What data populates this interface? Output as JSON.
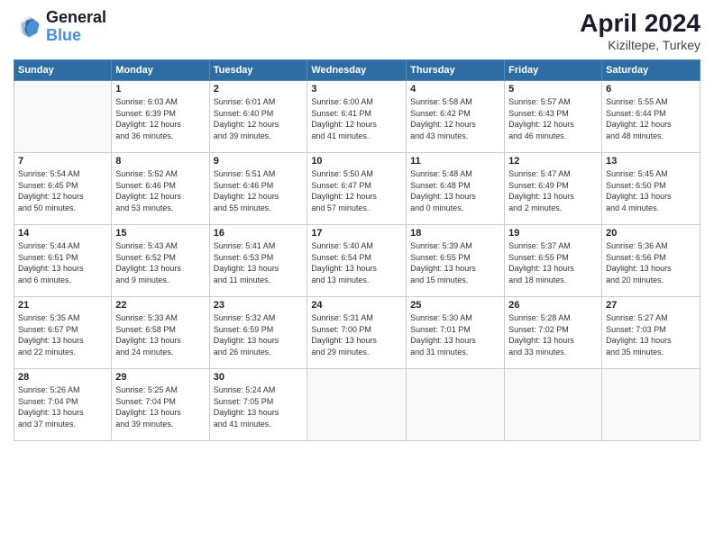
{
  "header": {
    "logo_general": "General",
    "logo_blue": "Blue",
    "month_year": "April 2024",
    "location": "Kiziltepe, Turkey"
  },
  "weekdays": [
    "Sunday",
    "Monday",
    "Tuesday",
    "Wednesday",
    "Thursday",
    "Friday",
    "Saturday"
  ],
  "weeks": [
    [
      {
        "day": "",
        "info": ""
      },
      {
        "day": "1",
        "info": "Sunrise: 6:03 AM\nSunset: 6:39 PM\nDaylight: 12 hours\nand 36 minutes."
      },
      {
        "day": "2",
        "info": "Sunrise: 6:01 AM\nSunset: 6:40 PM\nDaylight: 12 hours\nand 39 minutes."
      },
      {
        "day": "3",
        "info": "Sunrise: 6:00 AM\nSunset: 6:41 PM\nDaylight: 12 hours\nand 41 minutes."
      },
      {
        "day": "4",
        "info": "Sunrise: 5:58 AM\nSunset: 6:42 PM\nDaylight: 12 hours\nand 43 minutes."
      },
      {
        "day": "5",
        "info": "Sunrise: 5:57 AM\nSunset: 6:43 PM\nDaylight: 12 hours\nand 46 minutes."
      },
      {
        "day": "6",
        "info": "Sunrise: 5:55 AM\nSunset: 6:44 PM\nDaylight: 12 hours\nand 48 minutes."
      }
    ],
    [
      {
        "day": "7",
        "info": "Sunrise: 5:54 AM\nSunset: 6:45 PM\nDaylight: 12 hours\nand 50 minutes."
      },
      {
        "day": "8",
        "info": "Sunrise: 5:52 AM\nSunset: 6:46 PM\nDaylight: 12 hours\nand 53 minutes."
      },
      {
        "day": "9",
        "info": "Sunrise: 5:51 AM\nSunset: 6:46 PM\nDaylight: 12 hours\nand 55 minutes."
      },
      {
        "day": "10",
        "info": "Sunrise: 5:50 AM\nSunset: 6:47 PM\nDaylight: 12 hours\nand 57 minutes."
      },
      {
        "day": "11",
        "info": "Sunrise: 5:48 AM\nSunset: 6:48 PM\nDaylight: 13 hours\nand 0 minutes."
      },
      {
        "day": "12",
        "info": "Sunrise: 5:47 AM\nSunset: 6:49 PM\nDaylight: 13 hours\nand 2 minutes."
      },
      {
        "day": "13",
        "info": "Sunrise: 5:45 AM\nSunset: 6:50 PM\nDaylight: 13 hours\nand 4 minutes."
      }
    ],
    [
      {
        "day": "14",
        "info": "Sunrise: 5:44 AM\nSunset: 6:51 PM\nDaylight: 13 hours\nand 6 minutes."
      },
      {
        "day": "15",
        "info": "Sunrise: 5:43 AM\nSunset: 6:52 PM\nDaylight: 13 hours\nand 9 minutes."
      },
      {
        "day": "16",
        "info": "Sunrise: 5:41 AM\nSunset: 6:53 PM\nDaylight: 13 hours\nand 11 minutes."
      },
      {
        "day": "17",
        "info": "Sunrise: 5:40 AM\nSunset: 6:54 PM\nDaylight: 13 hours\nand 13 minutes."
      },
      {
        "day": "18",
        "info": "Sunrise: 5:39 AM\nSunset: 6:55 PM\nDaylight: 13 hours\nand 15 minutes."
      },
      {
        "day": "19",
        "info": "Sunrise: 5:37 AM\nSunset: 6:55 PM\nDaylight: 13 hours\nand 18 minutes."
      },
      {
        "day": "20",
        "info": "Sunrise: 5:36 AM\nSunset: 6:56 PM\nDaylight: 13 hours\nand 20 minutes."
      }
    ],
    [
      {
        "day": "21",
        "info": "Sunrise: 5:35 AM\nSunset: 6:57 PM\nDaylight: 13 hours\nand 22 minutes."
      },
      {
        "day": "22",
        "info": "Sunrise: 5:33 AM\nSunset: 6:58 PM\nDaylight: 13 hours\nand 24 minutes."
      },
      {
        "day": "23",
        "info": "Sunrise: 5:32 AM\nSunset: 6:59 PM\nDaylight: 13 hours\nand 26 minutes."
      },
      {
        "day": "24",
        "info": "Sunrise: 5:31 AM\nSunset: 7:00 PM\nDaylight: 13 hours\nand 29 minutes."
      },
      {
        "day": "25",
        "info": "Sunrise: 5:30 AM\nSunset: 7:01 PM\nDaylight: 13 hours\nand 31 minutes."
      },
      {
        "day": "26",
        "info": "Sunrise: 5:28 AM\nSunset: 7:02 PM\nDaylight: 13 hours\nand 33 minutes."
      },
      {
        "day": "27",
        "info": "Sunrise: 5:27 AM\nSunset: 7:03 PM\nDaylight: 13 hours\nand 35 minutes."
      }
    ],
    [
      {
        "day": "28",
        "info": "Sunrise: 5:26 AM\nSunset: 7:04 PM\nDaylight: 13 hours\nand 37 minutes."
      },
      {
        "day": "29",
        "info": "Sunrise: 5:25 AM\nSunset: 7:04 PM\nDaylight: 13 hours\nand 39 minutes."
      },
      {
        "day": "30",
        "info": "Sunrise: 5:24 AM\nSunset: 7:05 PM\nDaylight: 13 hours\nand 41 minutes."
      },
      {
        "day": "",
        "info": ""
      },
      {
        "day": "",
        "info": ""
      },
      {
        "day": "",
        "info": ""
      },
      {
        "day": "",
        "info": ""
      }
    ]
  ]
}
